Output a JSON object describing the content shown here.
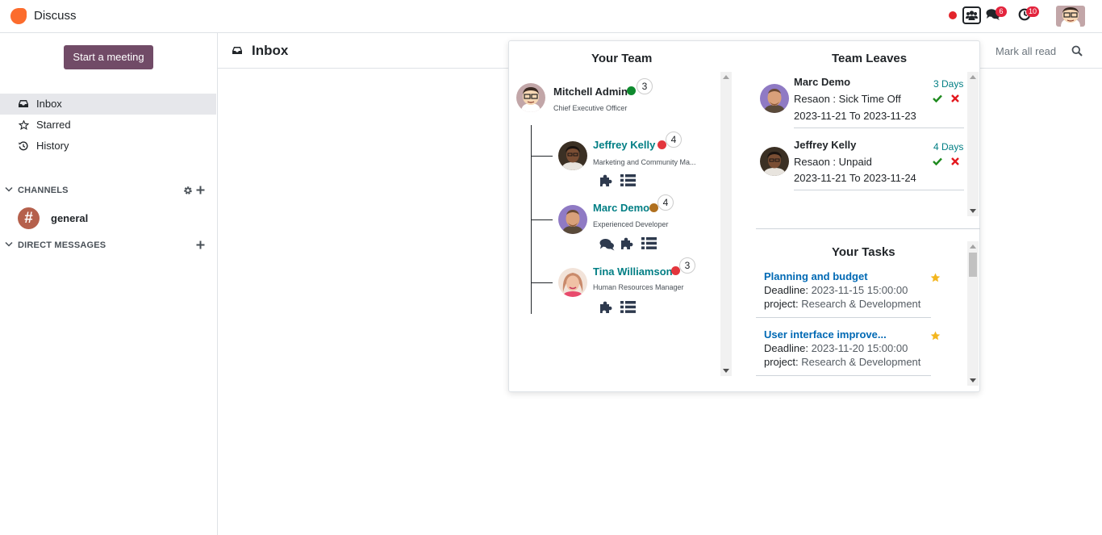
{
  "app": {
    "name": "Discuss"
  },
  "navbar": {
    "messages_badge": "6",
    "activities_badge": "10"
  },
  "sidebar": {
    "meeting_button": "Start a meeting",
    "items": [
      {
        "label": "Inbox"
      },
      {
        "label": "Starred"
      },
      {
        "label": "History"
      }
    ],
    "channels_label": "CHANNELS",
    "channel_general": "general",
    "channel_general_glyph": "#",
    "direct_messages_label": "DIRECT MESSAGES"
  },
  "main": {
    "title": "Inbox",
    "mark_all_read": "Mark all read"
  },
  "team": {
    "title": "Your Team",
    "manager": {
      "name": "Mitchell Admin",
      "job": "Chief Executive Officer",
      "count": "3",
      "status_color": "#0f8a2e"
    },
    "members": [
      {
        "name": "Jeffrey Kelly",
        "job": "Marketing and Community Ma...",
        "count": "4",
        "status_color": "#e3363d"
      },
      {
        "name": "Marc Demo",
        "job": "Experienced Developer",
        "count": "4",
        "status_color": "#b0701f"
      },
      {
        "name": "Tina Williamson",
        "job": "Human Resources Manager",
        "count": "3",
        "status_color": "#e3363d"
      }
    ]
  },
  "leaves": {
    "title": "Team Leaves",
    "items": [
      {
        "name": "Marc Demo",
        "reason": "Resaon : Sick Time Off",
        "range": "2023-11-21 To 2023-11-23",
        "days": "3 Days"
      },
      {
        "name": "Jeffrey Kelly",
        "reason": "Resaon : Unpaid",
        "range": "2023-11-21 To 2023-11-24",
        "days": "4 Days"
      }
    ]
  },
  "tasks": {
    "title": "Your Tasks",
    "deadline_label": "Deadline:",
    "project_label": "project:",
    "items": [
      {
        "title": "Planning and budget",
        "deadline": "2023-11-15 15:00:00",
        "project": "Research & Development"
      },
      {
        "title": "User interface improve...",
        "deadline": "2023-11-20 15:00:00",
        "project": "Research & Development"
      }
    ]
  },
  "colors": {
    "brand": "#714b67",
    "link": "#0069b4",
    "teal": "#017e84",
    "badge": "#e3243d"
  }
}
